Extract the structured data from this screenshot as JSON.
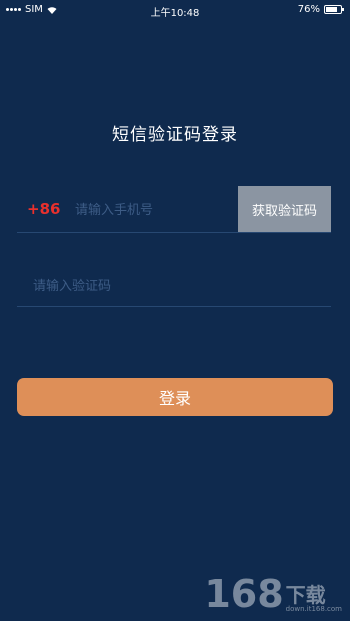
{
  "status_bar": {
    "carrier": "SIM",
    "time": "上午10:48",
    "battery": "76%",
    "battery_level": 0.76
  },
  "title": "短信验证码登录",
  "phone": {
    "country_code": "+86",
    "placeholder": "请输入手机号",
    "value": ""
  },
  "get_code_label": "获取验证码",
  "code": {
    "placeholder": "请输入验证码",
    "value": ""
  },
  "login_label": "登录",
  "colors": {
    "background": "#0f2a4e",
    "country_code": "#e8302d",
    "get_code_bg": "#8b95a2",
    "login_bg": "#de8f58"
  },
  "watermark": {
    "number": "168",
    "text": "下载",
    "url": "down.it168.com"
  }
}
